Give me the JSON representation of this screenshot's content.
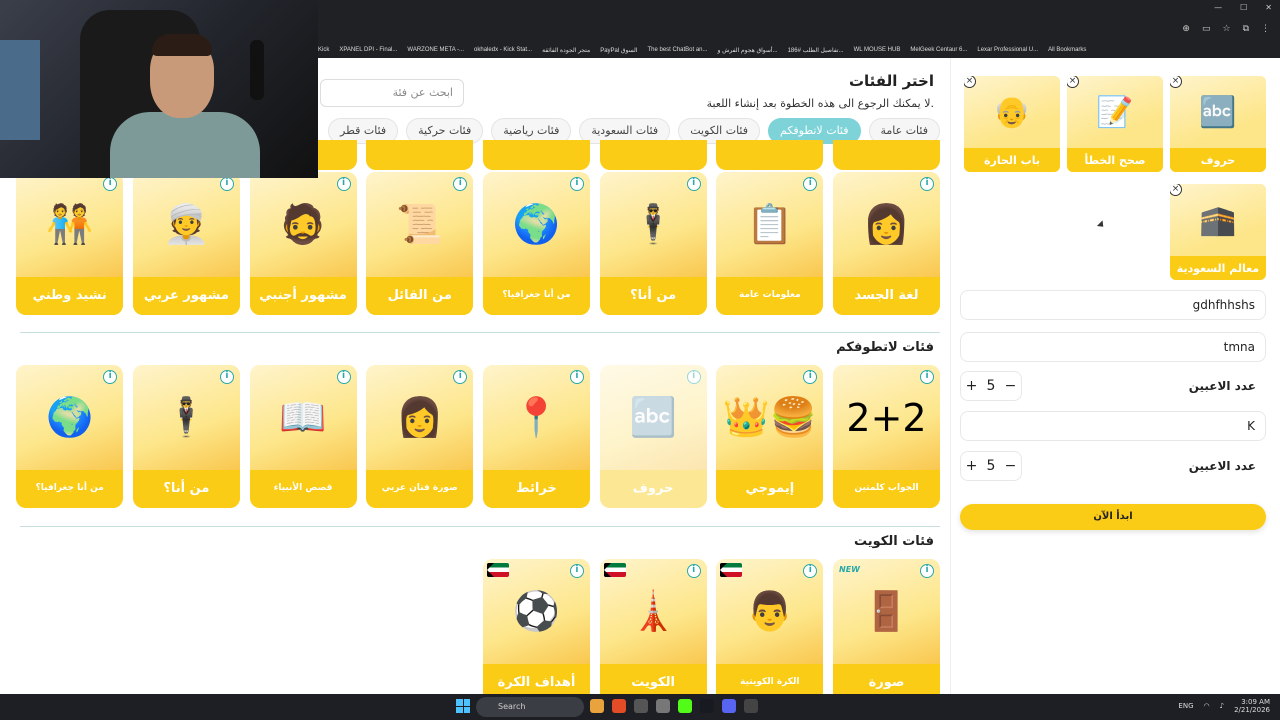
{
  "browser": {
    "bookmarks": [
      "Kick",
      "XPANEL DPI - Final...",
      "WARZONE META -...",
      "okhaledx - Kick Stat...",
      "متجر الجودة الفائقة",
      "PayPal السوق",
      "The best ChatBot an...",
      "أسواق هجوم الفرش و...",
      "تفاصيل الطلب #186...",
      "WL MOUSE HUB",
      "MelGeek Centaur 6...",
      "Lexar Professional U...",
      "All Bookmarks"
    ]
  },
  "header": {
    "title": "اختر الفئات",
    "subtitle": "لا يمكنك الرجوع الى هذه الخطوة بعد إنشاء اللعبة.",
    "search_placeholder": "ابحث عن فئة"
  },
  "filters": [
    {
      "label": "فئات عامة",
      "active": false
    },
    {
      "label": "فئات لاتطوفكم",
      "active": true
    },
    {
      "label": "فئات الكويت",
      "active": false
    },
    {
      "label": "فئات السعودية",
      "active": false
    },
    {
      "label": "فئات رياضية",
      "active": false
    },
    {
      "label": "فئات حركية",
      "active": false
    },
    {
      "label": "فئات قطر",
      "active": false
    }
  ],
  "sections": {
    "general": {
      "cards": [
        {
          "label": "لغة الجسد",
          "icon": "👩"
        },
        {
          "label": "معلومات عامة",
          "icon": "📋"
        },
        {
          "label": "من أنا؟",
          "icon": "🕴"
        },
        {
          "label": "من أنا جغرافيا؟",
          "icon": "🌍"
        },
        {
          "label": "من القائل",
          "icon": "📜"
        },
        {
          "label": "مشهور أجنبي",
          "icon": "🧔"
        },
        {
          "label": "مشهور عربي",
          "icon": "👳"
        },
        {
          "label": "نشيد وطني",
          "icon": "🧑‍🤝‍🧑"
        }
      ]
    },
    "latatofkum": {
      "title": "فئات لاتطوفكم",
      "cards": [
        {
          "label": "الجواب كلمتين",
          "icon": "2+2"
        },
        {
          "label": "إيموجي",
          "icon": "👑🍔"
        },
        {
          "label": "حروف",
          "icon": "🔤",
          "faded": true
        },
        {
          "label": "خرائط",
          "icon": "📍"
        },
        {
          "label": "صورة فنان عربي",
          "icon": "👩"
        },
        {
          "label": "قصص الأنبياء",
          "icon": "📖"
        },
        {
          "label": "من أنا؟",
          "icon": "🕴"
        },
        {
          "label": "من أنا جغرافيا؟",
          "icon": "🌍"
        }
      ]
    },
    "kuwait": {
      "title": "فئات الكويت",
      "cards": [
        {
          "label": "صورة",
          "icon": "🚪",
          "new": "NEW"
        },
        {
          "label": "الكرة الكويتية",
          "icon": "👨"
        },
        {
          "label": "الكويت",
          "icon": "🗼"
        },
        {
          "label": "أهداف الكرة",
          "icon": "⚽"
        }
      ]
    }
  },
  "selected": [
    {
      "label": "حروف",
      "icon": "🔤"
    },
    {
      "label": "صحح الخطأ",
      "icon": "📝"
    },
    {
      "label": "باب الحارة",
      "icon": "👴"
    },
    {
      "label": "معالم السعودية",
      "icon": "🕋"
    }
  ],
  "teams": [
    {
      "name": "gdhfhhshs"
    },
    {
      "name": "tmna"
    }
  ],
  "player_blocks": [
    {
      "name": "K",
      "label": "عدد الاعبين",
      "count": "5"
    },
    {
      "label": "عدد الاعبين",
      "count": "5"
    }
  ],
  "start_button": "ابدأ الآن",
  "taskbar": {
    "search": "Search",
    "lang": "ENG",
    "time": "3:09 AM",
    "date": "2/21/2026"
  }
}
